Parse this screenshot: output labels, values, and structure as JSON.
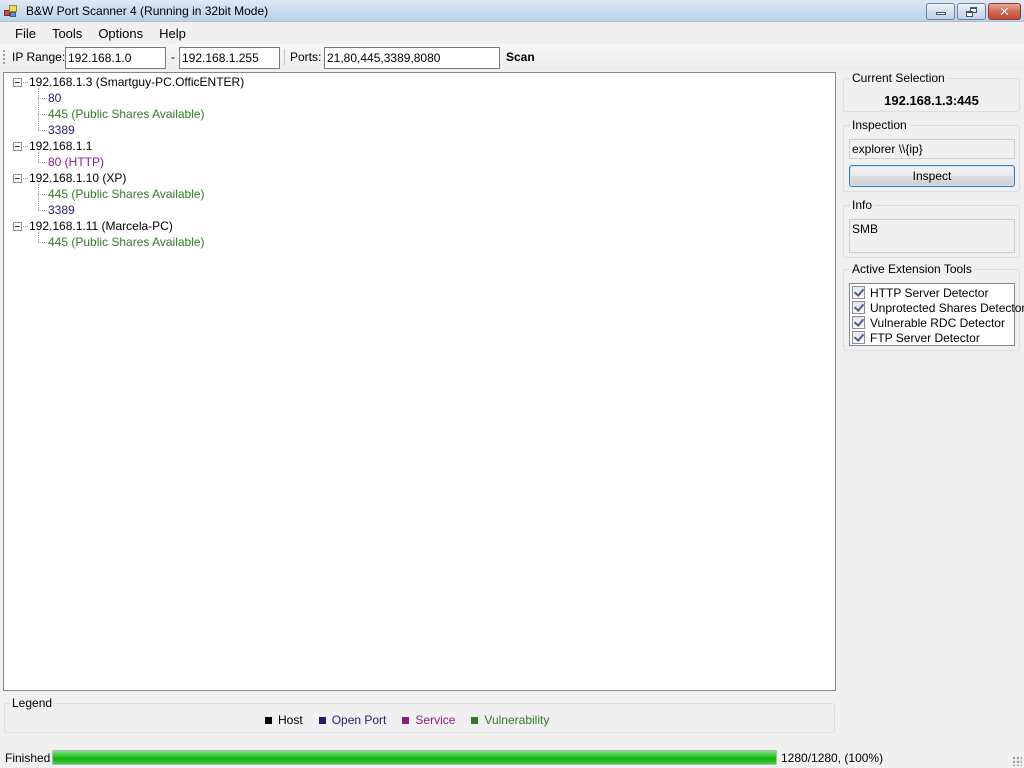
{
  "window": {
    "title": "B&W Port Scanner 4 (Running in 32bit Mode)",
    "controls": {
      "minimize": "minimize",
      "restore": "restore",
      "close": "close"
    }
  },
  "menu": [
    "File",
    "Tools",
    "Options",
    "Help"
  ],
  "toolbar": {
    "ip_range_label": "IP Range:",
    "ip_start": "192.168.1.0",
    "range_separator": "-",
    "ip_end": "192.168.1.255",
    "ports_label": "Ports:",
    "ports": "21,80,445,3389,8080",
    "scan_label": "Scan"
  },
  "tree": {
    "hosts": [
      {
        "label": "192.168.1.3 (Smartguy-PC.OfficENTER)",
        "children": [
          {
            "label": "80",
            "kind": "port"
          },
          {
            "label": "445 (Public Shares Available)",
            "kind": "vuln"
          },
          {
            "label": "3389",
            "kind": "port"
          }
        ]
      },
      {
        "label": "192.168.1.1",
        "children": [
          {
            "label": "80 (HTTP)",
            "kind": "service"
          }
        ]
      },
      {
        "label": "192.168.1.10 (XP)",
        "children": [
          {
            "label": "445 (Public Shares Available)",
            "kind": "vuln"
          },
          {
            "label": "3389",
            "kind": "port"
          }
        ]
      },
      {
        "label": "192.168.1.11 (Marcela-PC)",
        "children": [
          {
            "label": "445 (Public Shares Available)",
            "kind": "vuln"
          }
        ]
      }
    ]
  },
  "side": {
    "current_selection_label": "Current Selection",
    "current_selection_value": "192.168.1.3:445",
    "inspection_label": "Inspection",
    "inspection_command": "explorer \\\\{ip}",
    "inspect_button": "Inspect",
    "info_label": "Info",
    "info_value": "SMB",
    "extensions_label": "Active Extension Tools",
    "extensions": [
      {
        "label": "HTTP Server Detector",
        "checked": true
      },
      {
        "label": "Unprotected Shares Detector",
        "checked": true
      },
      {
        "label": "Vulnerable RDC Detector",
        "checked": true
      },
      {
        "label": "FTP Server Detector",
        "checked": true
      }
    ]
  },
  "legend": {
    "label": "Legend",
    "items": [
      {
        "label": "Host",
        "color": "#000000"
      },
      {
        "label": "Open Port",
        "color": "#1e1e78"
      },
      {
        "label": "Service",
        "color": "#8b1a8b"
      },
      {
        "label": "Vulnerability",
        "color": "#2e7d22"
      }
    ]
  },
  "status": {
    "text": "Finished",
    "progress_fraction": 1.0,
    "progress_label": "1280/1280, (100%)"
  },
  "colors": {
    "host": "#000000",
    "port": "#1e1e78",
    "service": "#8b1a8b",
    "vuln": "#2e7d22",
    "progress": "#10b010"
  }
}
